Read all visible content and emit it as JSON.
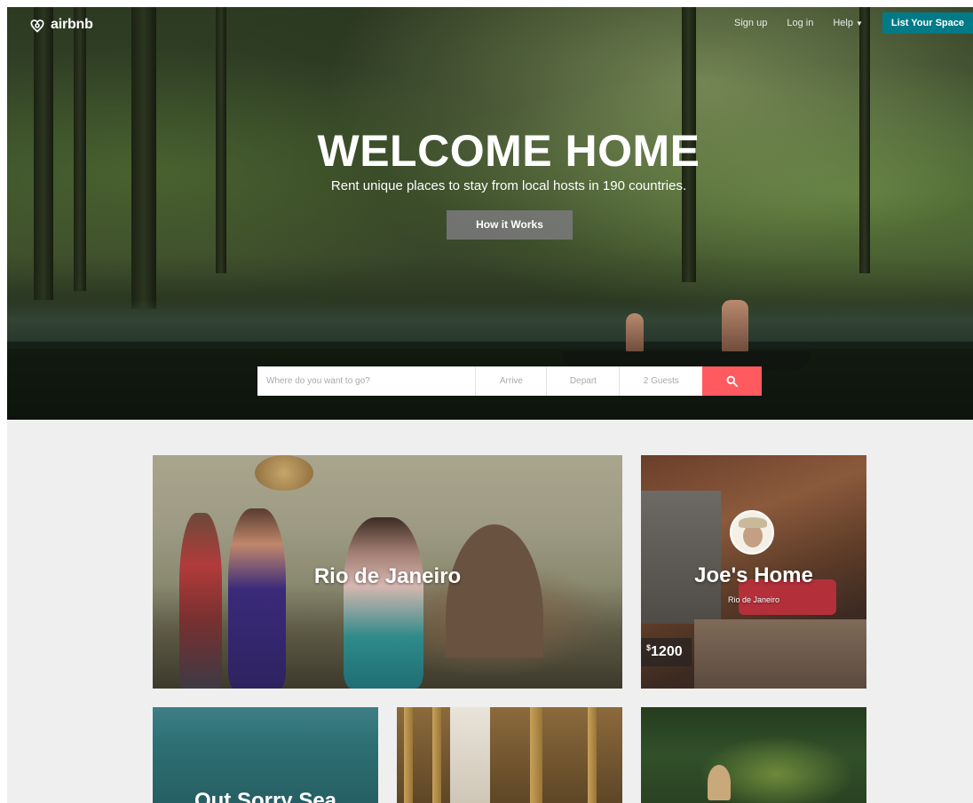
{
  "brand": {
    "name": "airbnb"
  },
  "nav": {
    "signup": "Sign up",
    "login": "Log in",
    "help": "Help",
    "list_space": "List Your Space"
  },
  "hero": {
    "title": "WELCOME HOME",
    "subtitle": "Rent unique places to stay from local hosts in 190 countries.",
    "cta": "How it Works"
  },
  "search": {
    "where_placeholder": "Where do you want to go?",
    "arrive_placeholder": "Arrive",
    "depart_placeholder": "Depart",
    "guests": "2 Guests"
  },
  "cards": {
    "rio": {
      "title": "Rio de Janeiro"
    },
    "joe": {
      "title": "Joe's Home",
      "subtitle": "Rio de Janeiro",
      "currency": "$",
      "price": "1200"
    },
    "sea": {
      "title": "Out Sorry Sea"
    }
  },
  "colors": {
    "brand_red": "#ff5a5f",
    "list_button": "#007a87"
  },
  "icons": {
    "logo": "airbnb-belo-icon",
    "search": "magnifier-icon",
    "help_caret": "caret-down-icon"
  }
}
